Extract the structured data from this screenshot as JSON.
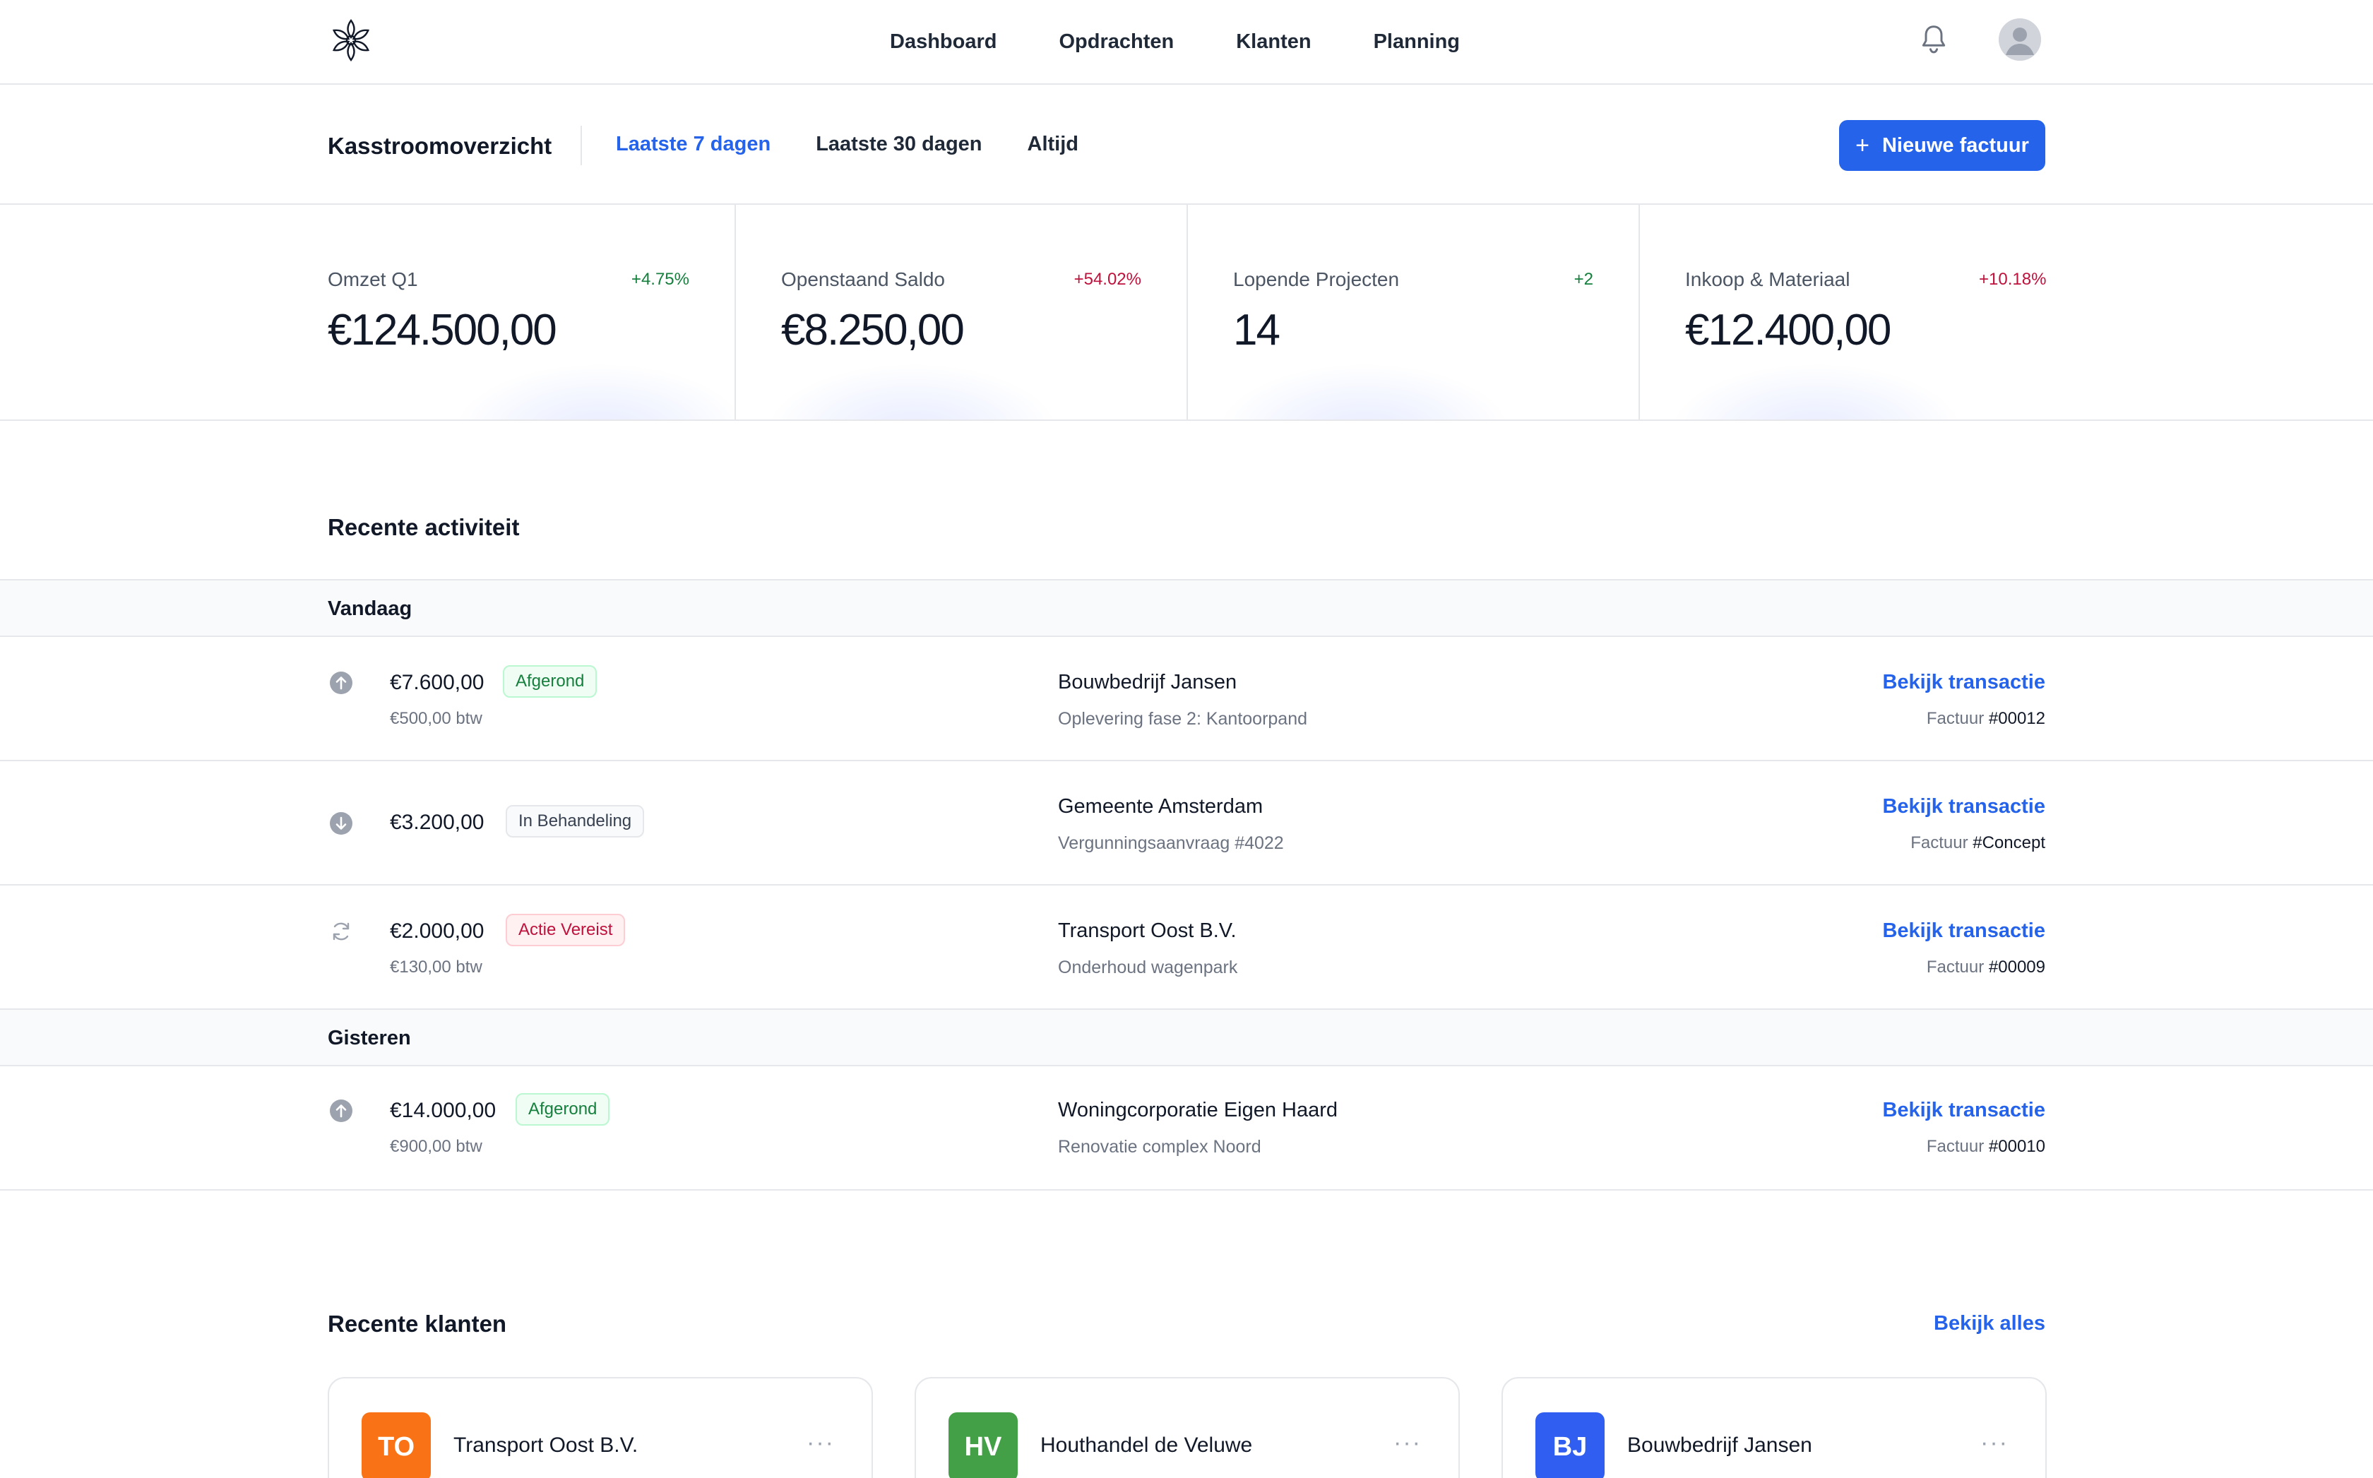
{
  "nav": {
    "links": [
      "Dashboard",
      "Opdrachten",
      "Klanten",
      "Planning"
    ]
  },
  "header": {
    "title": "Kasstroomoverzicht",
    "tabs": [
      "Laatste 7 dagen",
      "Laatste 30 dagen",
      "Altijd"
    ],
    "active_tab": "Laatste 7 dagen",
    "new_invoice_label": "Nieuwe factuur"
  },
  "stats": [
    {
      "label": "Omzet Q1",
      "change": "+4.75%",
      "value": "€124.500,00",
      "trend": "positive"
    },
    {
      "label": "Openstaand Saldo",
      "change": "+54.02%",
      "value": "€8.250,00",
      "trend": "negative"
    },
    {
      "label": "Lopende Projecten",
      "change": "+2",
      "value": "14",
      "trend": "positive"
    },
    {
      "label": "Inkoop & Materiaal",
      "change": "+10.18%",
      "value": "€12.400,00",
      "trend": "negative"
    }
  ],
  "activity": {
    "title": "Recente activiteit",
    "link_label": "Bekijk transactie",
    "invoice_prefix": "Factuur",
    "groups": [
      {
        "day": "Vandaag",
        "items": [
          {
            "icon": "arrow-up-circle-icon",
            "amount": "€7.600,00",
            "status": "Afgerond",
            "status_color": "green",
            "tax": "€500,00 btw",
            "client": "Bouwbedrijf Jansen",
            "description": "Oplevering fase 2: Kantoorpand",
            "invoice": "#00012"
          },
          {
            "icon": "arrow-down-circle-icon",
            "amount": "€3.200,00",
            "status": "In Behandeling",
            "status_color": "gray",
            "tax": "",
            "client": "Gemeente Amsterdam",
            "description": "Vergunningsaanvraag #4022",
            "invoice": "#Concept"
          },
          {
            "icon": "refresh-icon",
            "amount": "€2.000,00",
            "status": "Actie Vereist",
            "status_color": "red",
            "tax": "€130,00 btw",
            "client": "Transport Oost B.V.",
            "description": "Onderhoud wagenpark",
            "invoice": "#00009"
          }
        ]
      },
      {
        "day": "Gisteren",
        "items": [
          {
            "icon": "arrow-up-circle-icon",
            "amount": "€14.000,00",
            "status": "Afgerond",
            "status_color": "green",
            "tax": "€900,00 btw",
            "client": "Woningcorporatie Eigen Haard",
            "description": "Renovatie complex Noord",
            "invoice": "#00010"
          }
        ]
      }
    ]
  },
  "clients": {
    "title": "Recente klanten",
    "see_all_label": "Bekijk alles",
    "items": [
      {
        "initials": "TO",
        "name": "Transport Oost B.V.",
        "color": "#f97316"
      },
      {
        "initials": "HV",
        "name": "Houthandel de Veluwe",
        "color": "#43a047"
      },
      {
        "initials": "BJ",
        "name": "Bouwbedrijf Jansen",
        "color": "#2f5ef0"
      }
    ]
  },
  "colors": {
    "accent": "#2563eb",
    "positive": "#15803d",
    "negative": "#be123c"
  }
}
